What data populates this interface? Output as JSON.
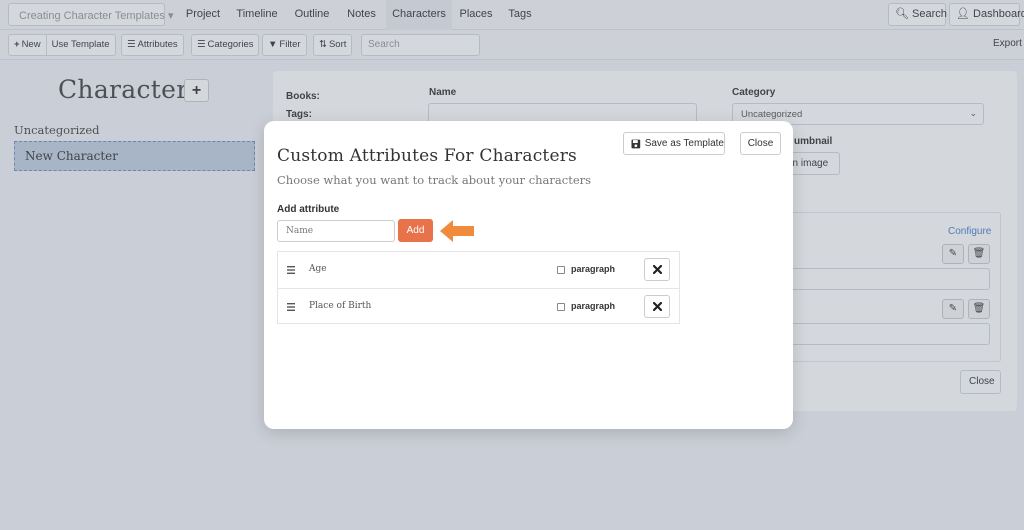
{
  "topnav": {
    "project_selector": "Creating Character Templates ▾",
    "items": [
      {
        "label": "Project"
      },
      {
        "label": "Timeline"
      },
      {
        "label": "Outline"
      },
      {
        "label": "Notes"
      },
      {
        "label": "Characters",
        "active": true
      },
      {
        "label": "Places"
      },
      {
        "label": "Tags"
      }
    ],
    "search_label": "Search",
    "dashboard_label": "Dashboard"
  },
  "toolbar": {
    "new_label": "New",
    "use_template_label": "Use Template",
    "attributes_label": "Attributes",
    "categories_label": "Categories",
    "filter_label": "Filter",
    "sort_label": "Sort",
    "search_placeholder": "Search",
    "export_label": "Export"
  },
  "sidebar": {
    "title": "Characters",
    "add_label": "+",
    "category": "Uncategorized",
    "selected_character": "New Character"
  },
  "detail": {
    "books_label": "Books:",
    "tags_label": "Tags:",
    "name_label": "Name",
    "category_label": "Category",
    "category_value": "Uncategorized",
    "thumbnail_label": "umbnail",
    "image_button_label": "an image",
    "configure_label": "Configure",
    "close_label": "Close"
  },
  "modal": {
    "title": "Custom Attributes For Characters",
    "subtitle": "Choose what you want to track about your characters",
    "save_template_label": "Save as Template",
    "close_label": "Close",
    "add_attribute_label": "Add attribute",
    "name_placeholder": "Name",
    "add_button_label": "Add",
    "attributes": [
      {
        "name": "Age",
        "type_label": "paragraph",
        "paragraph": false
      },
      {
        "name": "Place of Birth",
        "type_label": "paragraph",
        "paragraph": false
      }
    ]
  },
  "colors": {
    "accent": "#e8734a",
    "arrow": "#f08a3c",
    "selected_bg": "#c3d0e2"
  }
}
